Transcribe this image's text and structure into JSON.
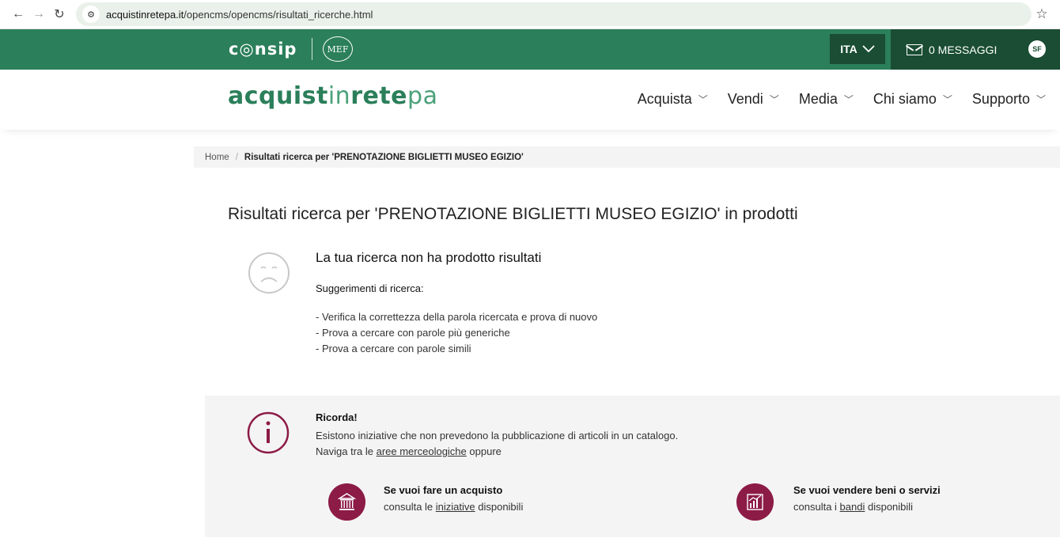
{
  "browser": {
    "url_domain": "acquistinretepa.it",
    "url_path": "/opencms/opencms/risultati_ricerche.html"
  },
  "topbar": {
    "logo": "c◎nsip",
    "mef": "MEF",
    "language": "ITA",
    "messages_label": "0 MESSAGGI",
    "avatar_initials": "SF"
  },
  "header": {
    "brand_bold": "acquist",
    "brand_light1": "in",
    "brand_bold2": "rete",
    "brand_light2": "pa",
    "nav": [
      {
        "label": "Acquista"
      },
      {
        "label": "Vendi"
      },
      {
        "label": "Media"
      },
      {
        "label": "Chi siamo"
      },
      {
        "label": "Supporto"
      }
    ]
  },
  "breadcrumb": {
    "home": "Home",
    "separator": "/",
    "current": "Risultati ricerca per 'PRENOTAZIONE BIGLIETTI MUSEO EGIZIO'"
  },
  "results": {
    "title": "Risultati ricerca per 'PRENOTAZIONE BIGLIETTI MUSEO EGIZIO' in prodotti",
    "no_results": "La tua ricerca non ha prodotto risultati",
    "suggestions_title": "Suggerimenti di ricerca:",
    "suggestions": [
      "- Verifica la correttezza della parola ricercata e prova di nuovo",
      "- Prova a cercare con parole più generiche",
      "- Prova a cercare con parole simili"
    ]
  },
  "info": {
    "title": "Ricorda!",
    "line1": "Esistono iniziative che non prevedono la pubblicazione di articoli in un catalogo.",
    "line2_prefix": "Naviga tra le ",
    "line2_link": "aree merceologiche",
    "line2_suffix": " oppure",
    "buy_title": "Se vuoi fare un acquisto",
    "buy_prefix": "consulta le ",
    "buy_link": "iniziative",
    "buy_suffix": " disponibili",
    "sell_title": "Se vuoi vendere beni o servizi",
    "sell_prefix": "consulta i ",
    "sell_link": "bandi",
    "sell_suffix": " disponibili"
  },
  "colors": {
    "consip_green": "#2b7f5a",
    "dark_green": "#1a4d33",
    "accent_maroon": "#8c1b46"
  }
}
